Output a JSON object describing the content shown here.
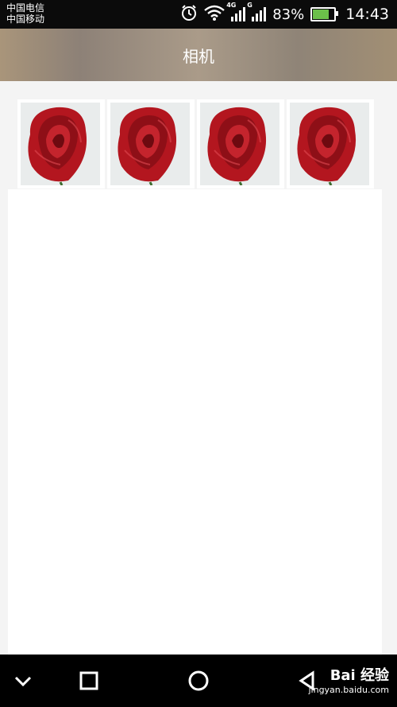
{
  "status_bar": {
    "carrier_1": "中国电信",
    "carrier_2": "中国移动",
    "network_1": "4G",
    "network_2": "G",
    "battery_percent": "83%",
    "battery_level": 0.83,
    "time": "14:43",
    "icons": [
      "alarm-icon",
      "wifi-icon",
      "signal-icon",
      "signal-icon",
      "battery-charging-icon"
    ]
  },
  "header": {
    "title": "相机"
  },
  "gallery": {
    "items": [
      {
        "image": "red-rose"
      },
      {
        "image": "red-rose"
      },
      {
        "image": "red-rose"
      },
      {
        "image": "red-rose"
      }
    ]
  },
  "nav_bar": {
    "icons": [
      "chevron-down-icon",
      "square-recents-icon",
      "circle-home-icon",
      "triangle-back-icon"
    ]
  },
  "watermark": {
    "main": "Bai 经验",
    "sub": "jingyan.baidu.com"
  },
  "colors": {
    "status_bar": "#0b0b0b",
    "title_bar": "#a9957a",
    "background": "#f4f4f4",
    "battery_fill": "#6cc04a",
    "rose": "#b3161f"
  }
}
